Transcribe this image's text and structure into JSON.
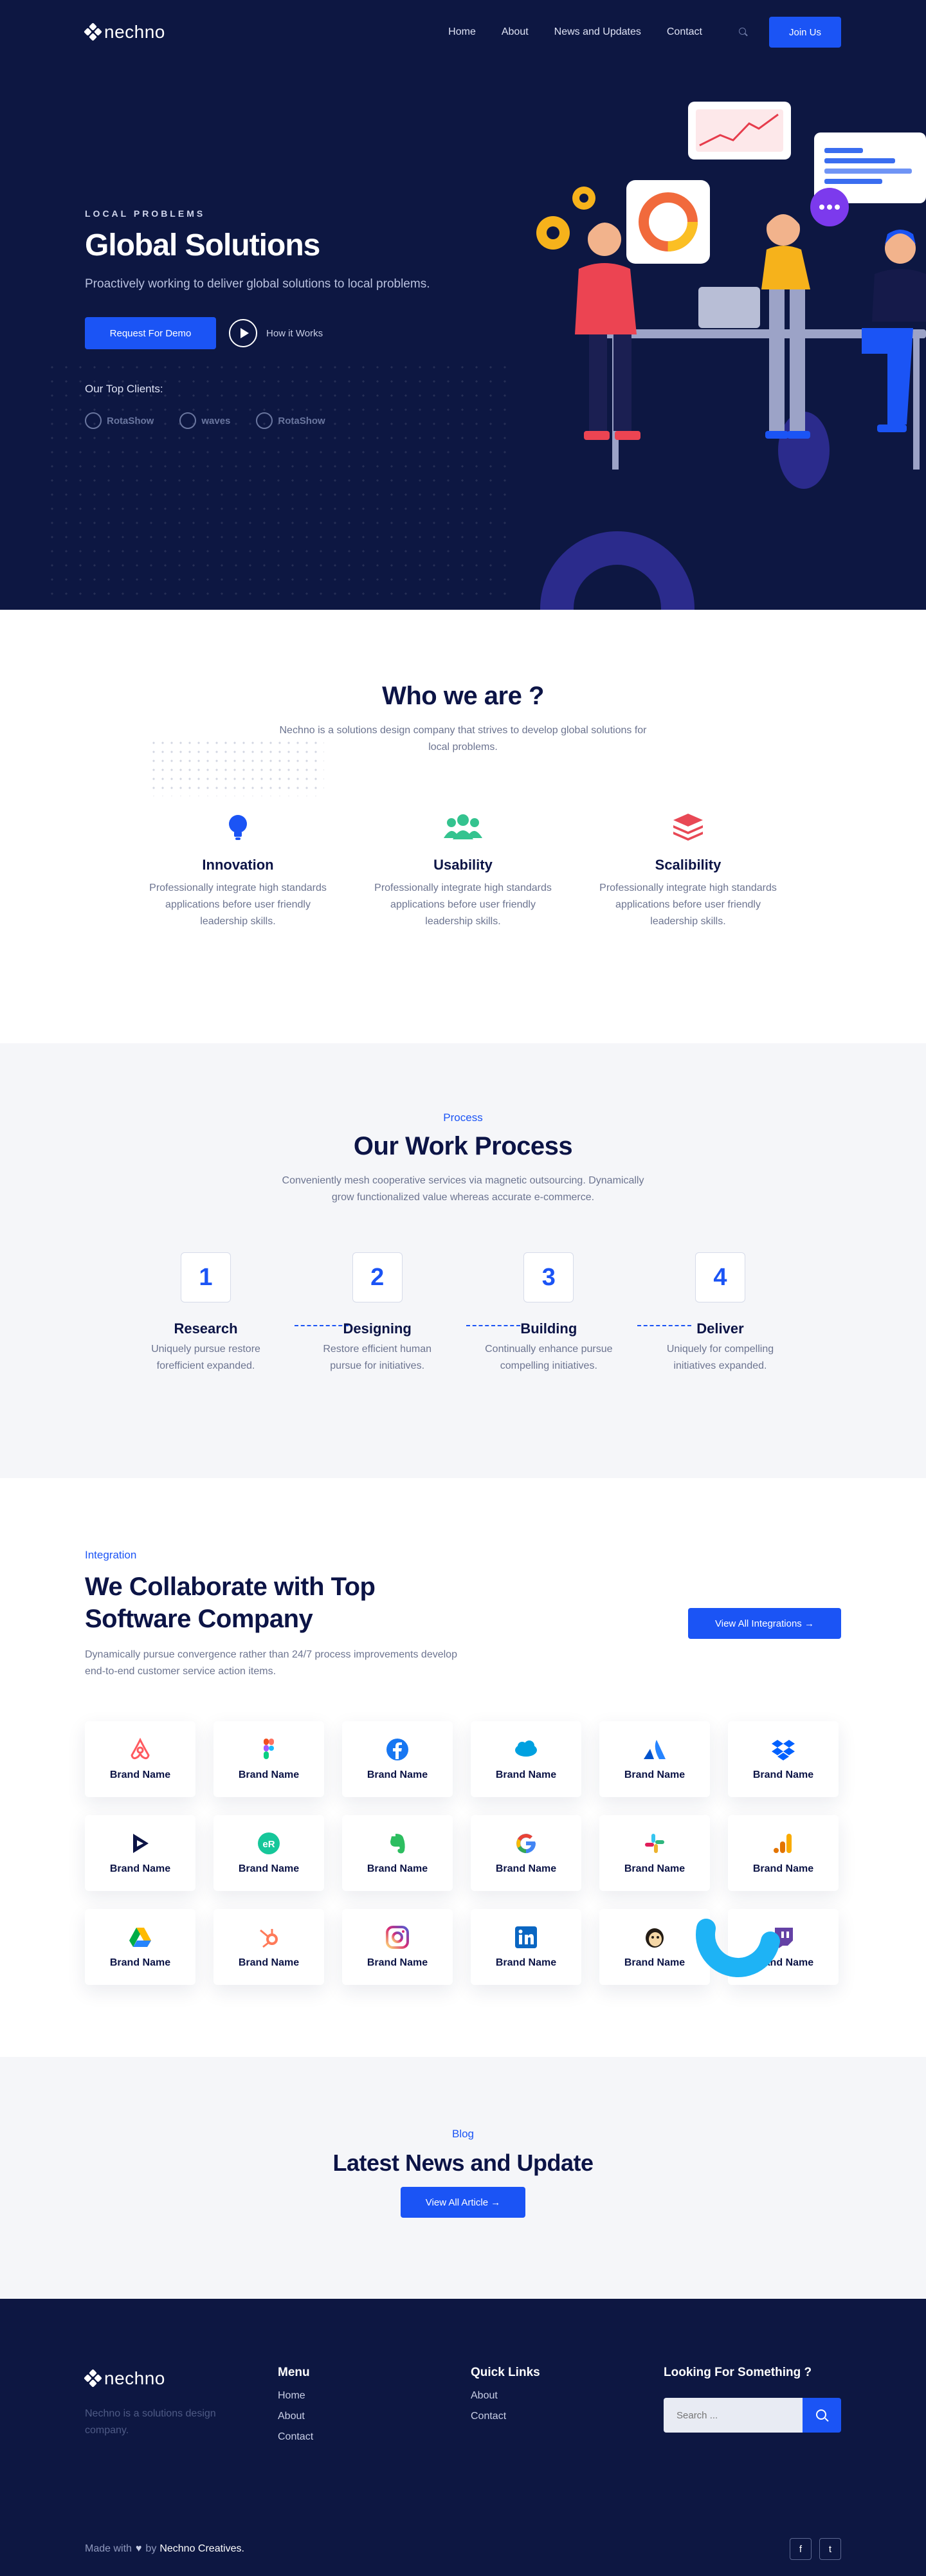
{
  "nav": {
    "brand": "nechno",
    "items": [
      "Home",
      "About",
      "News and Updates",
      "Contact"
    ],
    "join_label": "Join Us"
  },
  "hero": {
    "eyebrow": "LOCAL PROBLEMS",
    "title": "Global Solutions",
    "subtitle": "Proactively working to deliver global solutions to local problems.",
    "demo_label": "Request For Demo",
    "play_label": "How it Works",
    "clients_title": "Our Top Clients:",
    "clients": [
      "RotaShow",
      "waves",
      "RotaShow"
    ]
  },
  "who": {
    "title": "Who we are ?",
    "subtitle": "Nechno is a solutions design company that strives to develop global solutions for local problems.",
    "features": [
      {
        "icon": "lightbulb-icon",
        "title": "Innovation",
        "text": "Professionally integrate high standards applications before user friendly leadership skills."
      },
      {
        "icon": "users-icon",
        "title": "Usability",
        "text": "Professionally integrate high standards applications before user friendly leadership skills."
      },
      {
        "icon": "layers-icon",
        "title": "Scalibility",
        "text": "Professionally integrate high standards applications before user friendly leadership skills."
      }
    ]
  },
  "process": {
    "tag": "Process",
    "title": "Our Work Process",
    "subtitle": "Conveniently mesh cooperative services via magnetic outsourcing. Dynamically grow functionalized value whereas accurate e-commerce.",
    "steps": [
      {
        "num": "1",
        "title": "Research",
        "text": "Uniquely pursue restore forefficient expanded."
      },
      {
        "num": "2",
        "title": "Designing",
        "text": "Restore efficient human pursue for initiatives."
      },
      {
        "num": "3",
        "title": "Building",
        "text": "Continually enhance pursue compelling initiatives."
      },
      {
        "num": "4",
        "title": "Deliver",
        "text": "Uniquely for compelling initiatives expanded."
      }
    ]
  },
  "integration": {
    "tag": "Integration",
    "title_line1": "We Collaborate with Top",
    "title_line2": "Software Company",
    "subtitle": "Dynamically pursue convergence rather than 24/7 process improvements develop end-to-end customer service action items.",
    "view_all_label": "View All Integrations →",
    "brands": [
      {
        "icon": "airbnb-icon",
        "name": "Brand Name"
      },
      {
        "icon": "figma-icon",
        "name": "Brand Name"
      },
      {
        "icon": "facebook-icon",
        "name": "Brand Name"
      },
      {
        "icon": "salesforce-icon",
        "name": "Brand Name"
      },
      {
        "icon": "atlassian-icon",
        "name": "Brand Name"
      },
      {
        "icon": "dropbox-icon",
        "name": "Brand Name"
      },
      {
        "icon": "play-arrow-icon",
        "name": "Brand Name"
      },
      {
        "icon": "er-icon",
        "name": "Brand Name"
      },
      {
        "icon": "evernote-icon",
        "name": "Brand Name"
      },
      {
        "icon": "google-icon",
        "name": "Brand Name"
      },
      {
        "icon": "slack-icon",
        "name": "Brand Name"
      },
      {
        "icon": "analytics-icon",
        "name": "Brand Name"
      },
      {
        "icon": "google-drive-icon",
        "name": "Brand Name"
      },
      {
        "icon": "hubspot-icon",
        "name": "Brand Name"
      },
      {
        "icon": "instagram-icon",
        "name": "Brand Name"
      },
      {
        "icon": "linkedin-icon",
        "name": "Brand Name"
      },
      {
        "icon": "mailchimp-icon",
        "name": "Brand Name"
      },
      {
        "icon": "twitch-icon",
        "name": "Brand Name"
      }
    ]
  },
  "blog": {
    "tag": "Blog",
    "title": "Latest News and Update",
    "button_label": "View All Article →"
  },
  "footer": {
    "brand": "nechno",
    "about": "Nechno is a solutions design company.",
    "menu_title": "Menu",
    "menu_items": [
      "Home",
      "About",
      "Contact"
    ],
    "quick_title": "Quick Links",
    "quick_items": [
      "About",
      "Contact"
    ],
    "search_title": "Looking For Something ?",
    "search_placeholder": "Search ...",
    "made_prefix": "Made with",
    "made_by": "by",
    "made_author": "Nechno Creatives.",
    "social": [
      "f",
      "t"
    ]
  },
  "colors": {
    "navy": "#0d1742",
    "accent": "#1b54f5",
    "light_bg": "#f5f6f9"
  }
}
